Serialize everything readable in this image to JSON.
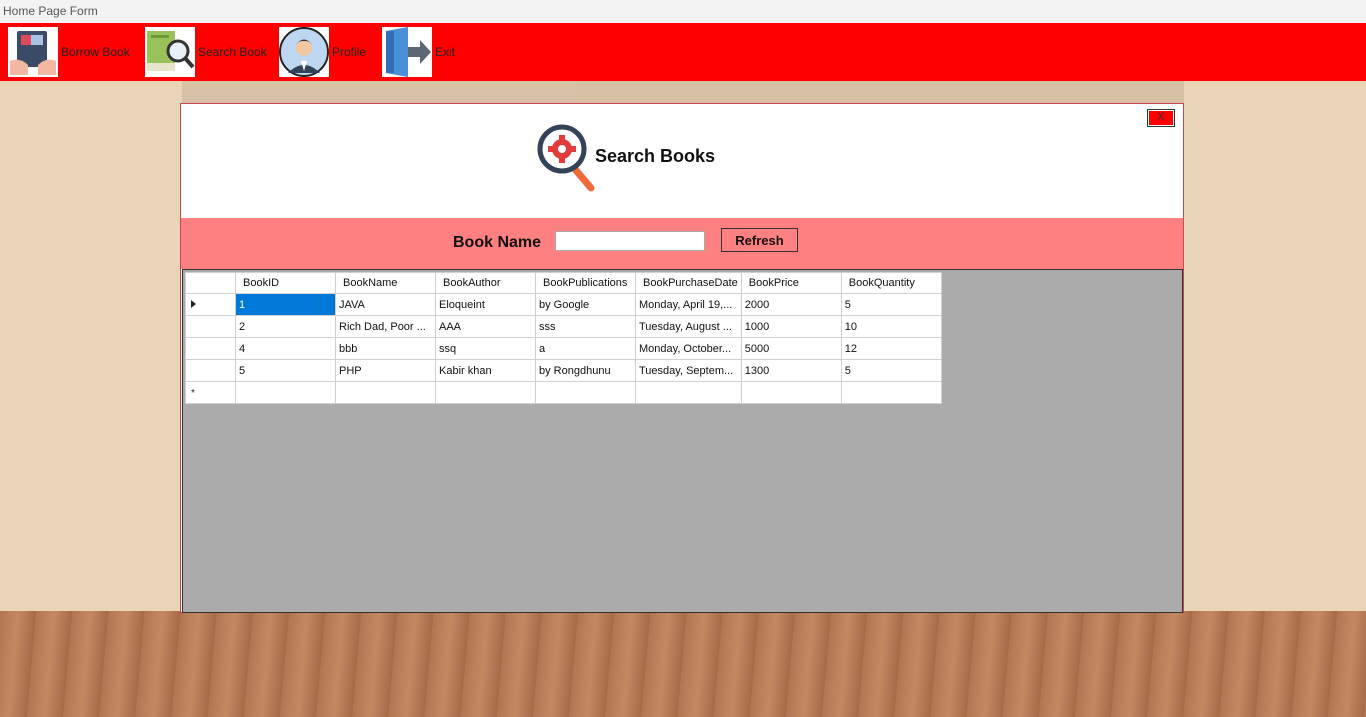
{
  "window": {
    "title": "Home Page Form"
  },
  "menu": {
    "items": [
      {
        "label": "Borrow Book",
        "icon": "borrow-book-icon"
      },
      {
        "label": "Search Book",
        "icon": "search-book-icon"
      },
      {
        "label": "Profile",
        "icon": "profile-icon"
      },
      {
        "label": "Exit",
        "icon": "exit-icon"
      }
    ]
  },
  "search_form": {
    "title": "Search Books",
    "close_label": "X",
    "book_name_label": "Book Name",
    "book_name_value": "",
    "refresh_label": "Refresh"
  },
  "grid": {
    "columns": [
      "BookID",
      "BookName",
      "BookAuthor",
      "BookPublications",
      "BookPurchaseDate",
      "BookPrice",
      "BookQuantity"
    ],
    "rows": [
      [
        "1",
        "JAVA",
        "Eloqueint",
        "by Google",
        "Monday, April 19,...",
        "2000",
        "5"
      ],
      [
        "2",
        "Rich Dad, Poor ...",
        "AAA",
        "sss",
        "Tuesday, August ...",
        "1000",
        "10"
      ],
      [
        "4",
        "bbb",
        "ssq",
        "a",
        "Monday, October...",
        "5000",
        "12"
      ],
      [
        "5",
        "PHP",
        "Kabir khan",
        "by Rongdhunu",
        "Tuesday, Septem...",
        "1300",
        "5"
      ]
    ],
    "new_row_marker": "*"
  },
  "colors": {
    "menubar": "#ff0000",
    "search_strip": "#ff8080",
    "selection": "#0078d7",
    "grid_background": "#ababab"
  }
}
